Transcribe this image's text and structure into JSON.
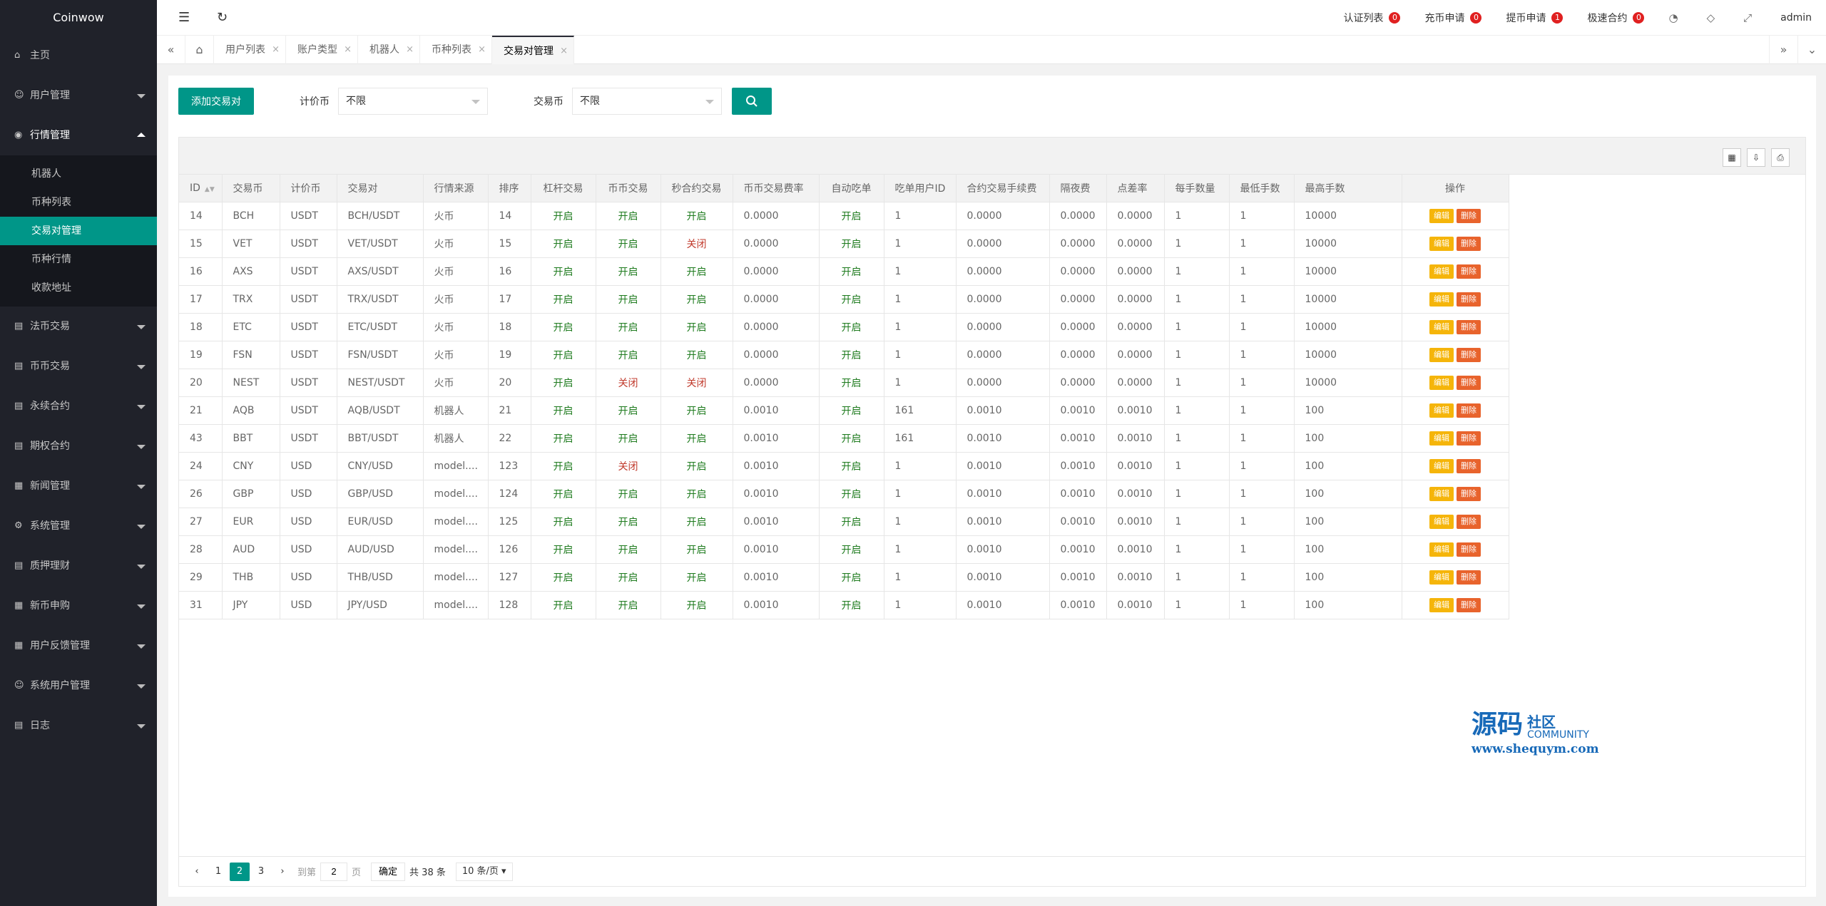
{
  "app": {
    "title": "Coinwow"
  },
  "sidebar": {
    "items": [
      {
        "label": "主页",
        "icon": "home-icon",
        "glyph": "⌂"
      },
      {
        "label": "用户管理",
        "icon": "user-icon",
        "glyph": "☺"
      },
      {
        "label": "行情管理",
        "icon": "market-icon",
        "glyph": "◉",
        "open": true,
        "children": [
          {
            "label": "机器人"
          },
          {
            "label": "币种列表"
          },
          {
            "label": "交易对管理",
            "active": true
          },
          {
            "label": "币种行情"
          },
          {
            "label": "收款地址"
          }
        ]
      },
      {
        "label": "法币交易",
        "icon": "fiat-trade-icon",
        "glyph": "▤"
      },
      {
        "label": "币币交易",
        "icon": "coin-trade-icon",
        "glyph": "▤"
      },
      {
        "label": "永续合约",
        "icon": "perpetual-icon",
        "glyph": "▤"
      },
      {
        "label": "期权合约",
        "icon": "option-icon",
        "glyph": "▤"
      },
      {
        "label": "新闻管理",
        "icon": "news-icon",
        "glyph": "▦"
      },
      {
        "label": "系统管理",
        "icon": "gear-icon",
        "glyph": "⚙"
      },
      {
        "label": "质押理财",
        "icon": "stake-icon",
        "glyph": "▤"
      },
      {
        "label": "新币申购",
        "icon": "ipo-icon",
        "glyph": "▦"
      },
      {
        "label": "用户反馈管理",
        "icon": "feedback-icon",
        "glyph": "▦"
      },
      {
        "label": "系统用户管理",
        "icon": "admin-user-icon",
        "glyph": "☺"
      },
      {
        "label": "日志",
        "icon": "log-icon",
        "glyph": "▤"
      }
    ]
  },
  "header": {
    "links": [
      {
        "label": "认证列表",
        "count": "0"
      },
      {
        "label": "充币申请",
        "count": "0"
      },
      {
        "label": "提币申请",
        "count": "1"
      },
      {
        "label": "极速合约",
        "count": "0"
      }
    ],
    "user": "admin"
  },
  "tabs": [
    {
      "label": "用户列表"
    },
    {
      "label": "账户类型"
    },
    {
      "label": "机器人"
    },
    {
      "label": "币种列表"
    },
    {
      "label": "交易对管理",
      "active": true
    }
  ],
  "toolbar": {
    "add_label": "添加交易对",
    "quote_label": "计价币",
    "quote_value": "不限",
    "base_label": "交易币",
    "base_value": "不限"
  },
  "table": {
    "columns": [
      "ID",
      "交易币",
      "计价币",
      "交易对",
      "行情来源",
      "排序",
      "杠杆交易",
      "币币交易",
      "秒合约交易",
      "币币交易费率",
      "自动吃单",
      "吃单用户ID",
      "合约交易手续费",
      "隔夜费",
      "点差率",
      "每手数量",
      "最低手数",
      "最高手数",
      "操作"
    ],
    "edit_label": "编辑",
    "delete_label": "删除",
    "rows": [
      [
        "14",
        "BCH",
        "USDT",
        "BCH/USDT",
        "火币",
        "14",
        "开启",
        "开启",
        "开启",
        "0.0000",
        "开启",
        "1",
        "0.0000",
        "0.0000",
        "0.0000",
        "1",
        "1",
        "10000"
      ],
      [
        "15",
        "VET",
        "USDT",
        "VET/USDT",
        "火币",
        "15",
        "开启",
        "开启",
        "关闭",
        "0.0000",
        "开启",
        "1",
        "0.0000",
        "0.0000",
        "0.0000",
        "1",
        "1",
        "10000"
      ],
      [
        "16",
        "AXS",
        "USDT",
        "AXS/USDT",
        "火币",
        "16",
        "开启",
        "开启",
        "开启",
        "0.0000",
        "开启",
        "1",
        "0.0000",
        "0.0000",
        "0.0000",
        "1",
        "1",
        "10000"
      ],
      [
        "17",
        "TRX",
        "USDT",
        "TRX/USDT",
        "火币",
        "17",
        "开启",
        "开启",
        "开启",
        "0.0000",
        "开启",
        "1",
        "0.0000",
        "0.0000",
        "0.0000",
        "1",
        "1",
        "10000"
      ],
      [
        "18",
        "ETC",
        "USDT",
        "ETC/USDT",
        "火币",
        "18",
        "开启",
        "开启",
        "开启",
        "0.0000",
        "开启",
        "1",
        "0.0000",
        "0.0000",
        "0.0000",
        "1",
        "1",
        "10000"
      ],
      [
        "19",
        "FSN",
        "USDT",
        "FSN/USDT",
        "火币",
        "19",
        "开启",
        "开启",
        "开启",
        "0.0000",
        "开启",
        "1",
        "0.0000",
        "0.0000",
        "0.0000",
        "1",
        "1",
        "10000"
      ],
      [
        "20",
        "NEST",
        "USDT",
        "NEST/USDT",
        "火币",
        "20",
        "开启",
        "关闭",
        "关闭",
        "0.0000",
        "开启",
        "1",
        "0.0000",
        "0.0000",
        "0.0000",
        "1",
        "1",
        "10000"
      ],
      [
        "21",
        "AQB",
        "USDT",
        "AQB/USDT",
        "机器人",
        "21",
        "开启",
        "开启",
        "开启",
        "0.0010",
        "开启",
        "161",
        "0.0010",
        "0.0010",
        "0.0010",
        "1",
        "1",
        "100"
      ],
      [
        "43",
        "BBT",
        "USDT",
        "BBT/USDT",
        "机器人",
        "22",
        "开启",
        "开启",
        "开启",
        "0.0010",
        "开启",
        "161",
        "0.0010",
        "0.0010",
        "0.0010",
        "1",
        "1",
        "100"
      ],
      [
        "24",
        "CNY",
        "USD",
        "CNY/USD",
        "model....",
        "123",
        "开启",
        "关闭",
        "开启",
        "0.0010",
        "开启",
        "1",
        "0.0010",
        "0.0010",
        "0.0010",
        "1",
        "1",
        "100"
      ],
      [
        "26",
        "GBP",
        "USD",
        "GBP/USD",
        "model....",
        "124",
        "开启",
        "开启",
        "开启",
        "0.0010",
        "开启",
        "1",
        "0.0010",
        "0.0010",
        "0.0010",
        "1",
        "1",
        "100"
      ],
      [
        "27",
        "EUR",
        "USD",
        "EUR/USD",
        "model....",
        "125",
        "开启",
        "开启",
        "开启",
        "0.0010",
        "开启",
        "1",
        "0.0010",
        "0.0010",
        "0.0010",
        "1",
        "1",
        "100"
      ],
      [
        "28",
        "AUD",
        "USD",
        "AUD/USD",
        "model....",
        "126",
        "开启",
        "开启",
        "开启",
        "0.0010",
        "开启",
        "1",
        "0.0010",
        "0.0010",
        "0.0010",
        "1",
        "1",
        "100"
      ],
      [
        "29",
        "THB",
        "USD",
        "THB/USD",
        "model....",
        "127",
        "开启",
        "开启",
        "开启",
        "0.0010",
        "开启",
        "1",
        "0.0010",
        "0.0010",
        "0.0010",
        "1",
        "1",
        "100"
      ],
      [
        "31",
        "JPY",
        "USD",
        "JPY/USD",
        "model....",
        "128",
        "开启",
        "开启",
        "开启",
        "0.0010",
        "开启",
        "1",
        "0.0010",
        "0.0010",
        "0.0010",
        "1",
        "1",
        "100"
      ]
    ]
  },
  "watermark": {
    "big": "源码",
    "small1": "社区",
    "small2": "COMMUNITY",
    "url": "www.shequym.com"
  },
  "pager": {
    "pages": [
      "1",
      "2",
      "3"
    ],
    "current": "2",
    "goto_label": "到第",
    "goto_value": "2",
    "page_unit": "页",
    "confirm_label": "确定",
    "total_label": "共 38 条",
    "per_page": "10 条/页"
  },
  "colors": {
    "accent": "#009688",
    "sidebar": "#20222a",
    "on": "#1e7b1e",
    "off": "#c0392b",
    "edit": "#f5b50a",
    "delete": "#e8632c",
    "badge": "#e02020"
  }
}
